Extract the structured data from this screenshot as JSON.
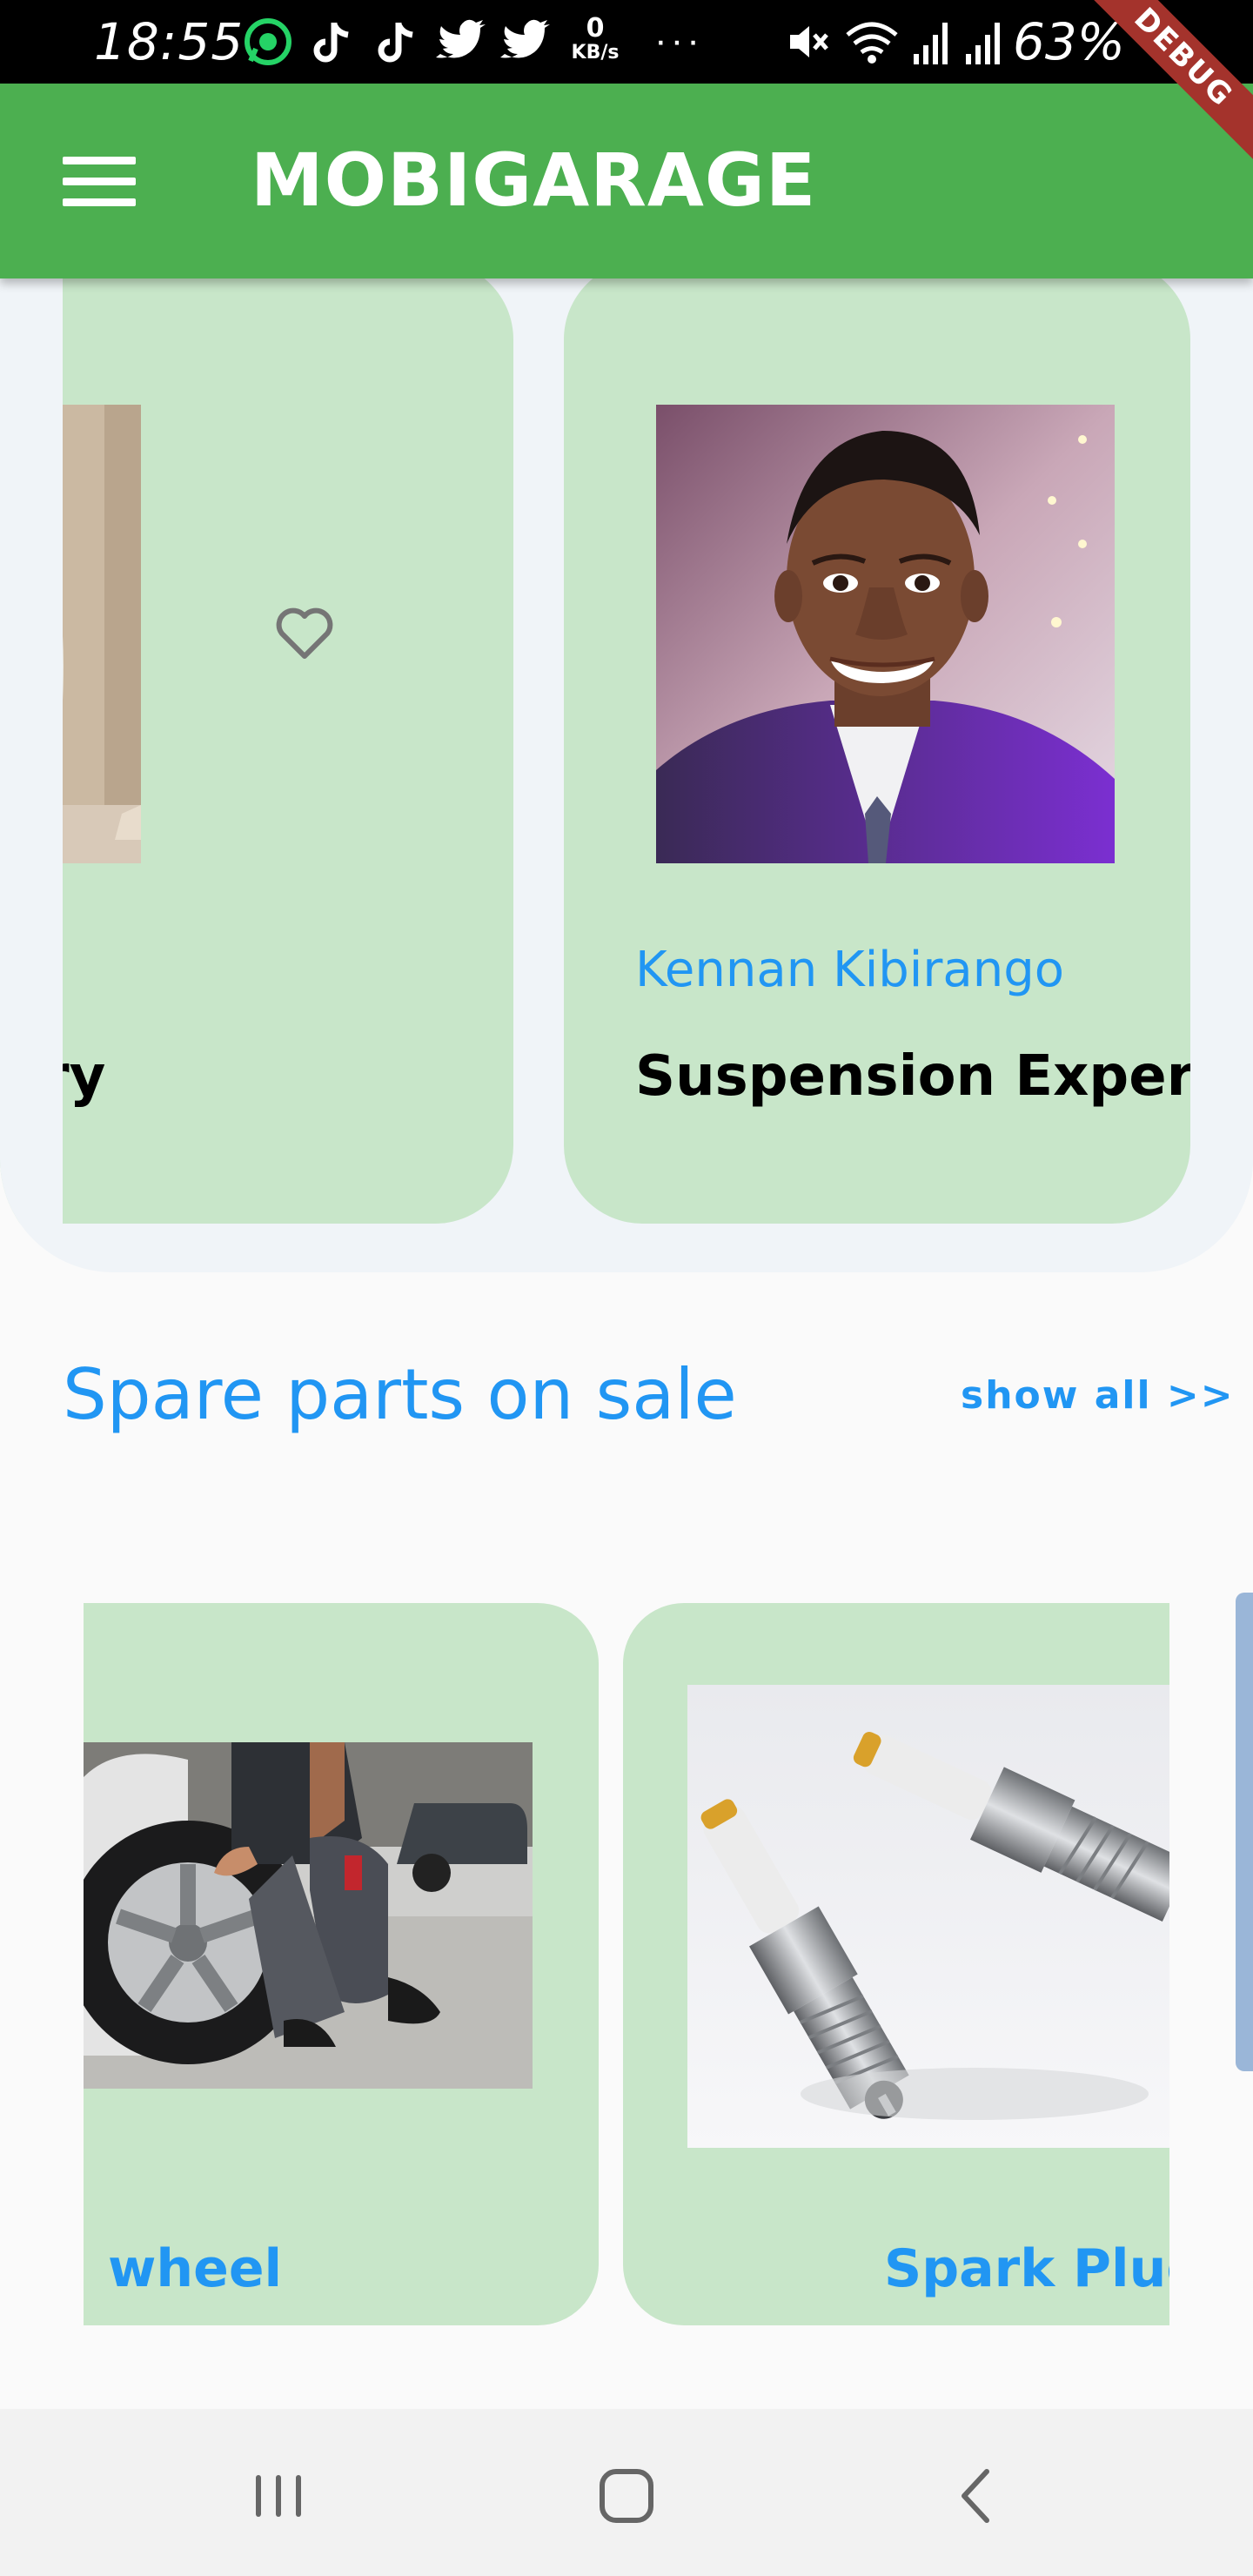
{
  "status_bar": {
    "time": "18:55",
    "net_speed_value": "0",
    "net_speed_unit": "KB/s",
    "more_dots": "···",
    "battery": "63%"
  },
  "debug_banner": "DEBUG",
  "app_bar": {
    "title": "MOBIGARAGE"
  },
  "mechanics": [
    {
      "name": "",
      "specialty": "ry",
      "liked": false
    },
    {
      "name": "Kennan Kibirango",
      "specialty": "Suspension Expert"
    }
  ],
  "spare_parts": {
    "title": "Spare parts on sale",
    "show_all_label": "show all >>",
    "items": [
      {
        "name": "wheel"
      },
      {
        "name": "Spark Plugs"
      }
    ]
  },
  "colors": {
    "primary": "#4caf50",
    "card": "#c8e6c9",
    "accent_text": "#2196f3",
    "debug": "#a4332c"
  }
}
